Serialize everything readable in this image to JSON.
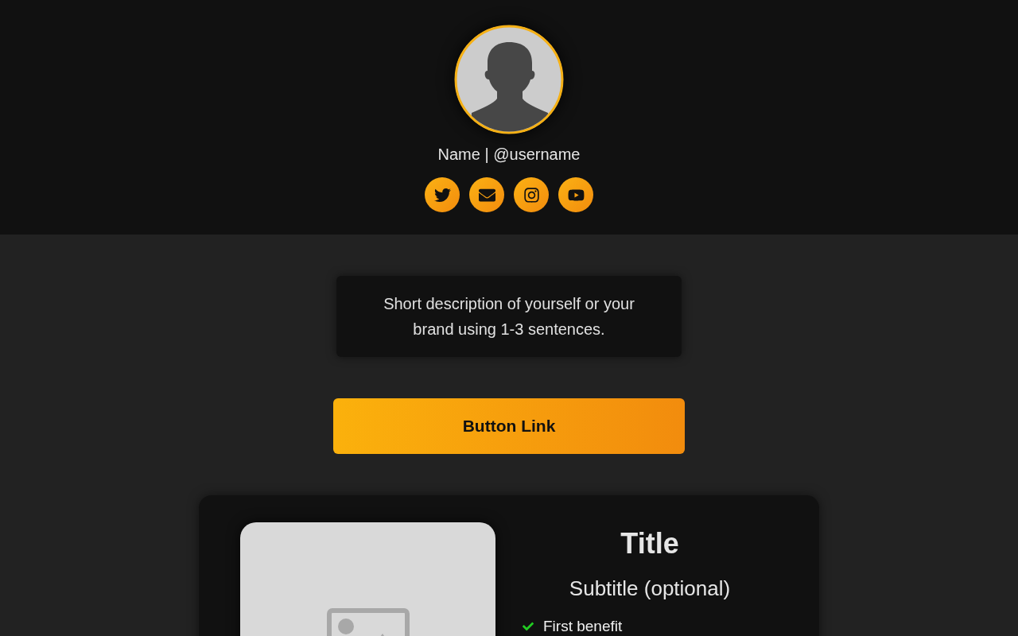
{
  "profile": {
    "name_line": "Name | @username"
  },
  "socials": [
    {
      "kind": "twitter"
    },
    {
      "kind": "email"
    },
    {
      "kind": "instagram"
    },
    {
      "kind": "youtube"
    }
  ],
  "description": "Short description of yourself or your brand using 1-3 sentences.",
  "button": {
    "label": "Button Link"
  },
  "product": {
    "image": {
      "kind": "placeholder"
    },
    "title": "Title",
    "subtitle": "Subtitle (optional)",
    "benefits": [
      {
        "text": "First benefit",
        "checked": true
      }
    ]
  }
}
